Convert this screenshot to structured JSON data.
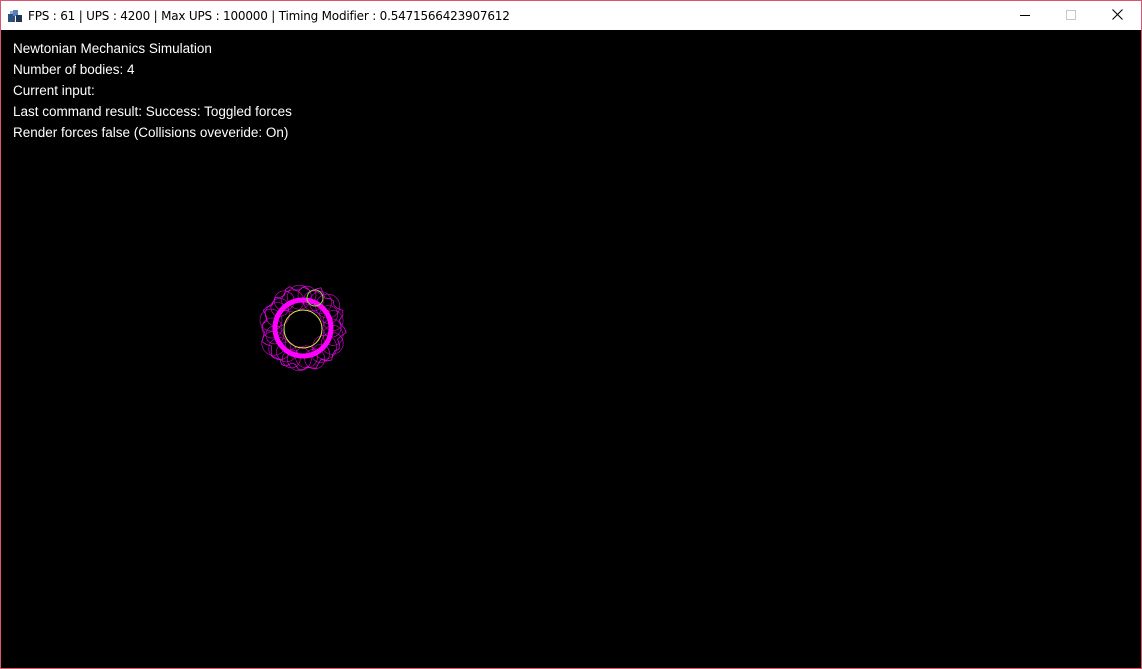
{
  "window": {
    "title": "FPS : 61 | UPS : 4200 | Max UPS : 100000 | Timing Modifier : 0.5471566423907612",
    "icon": "java-app-icon",
    "controls": {
      "minimize_icon": "minimize-icon",
      "maximize_icon": "maximize-icon",
      "close_icon": "close-icon"
    },
    "border_color": "#d9566e"
  },
  "hud": {
    "heading": "Newtonian Mechanics Simulation",
    "bodies": "Number of bodies: 4",
    "current_input": "Current input:",
    "last_command": "Last command result: Success: Toggled forces",
    "render_forces": "Render forces false (Collisions oveveride: On)"
  },
  "simulation": {
    "background": "#000000",
    "body_count": 4,
    "colors": {
      "primary_body": "#ff00ff",
      "trail": "#ff00ff",
      "secondary_body": "#d4f03c",
      "small_body": "#8fd14f"
    }
  }
}
